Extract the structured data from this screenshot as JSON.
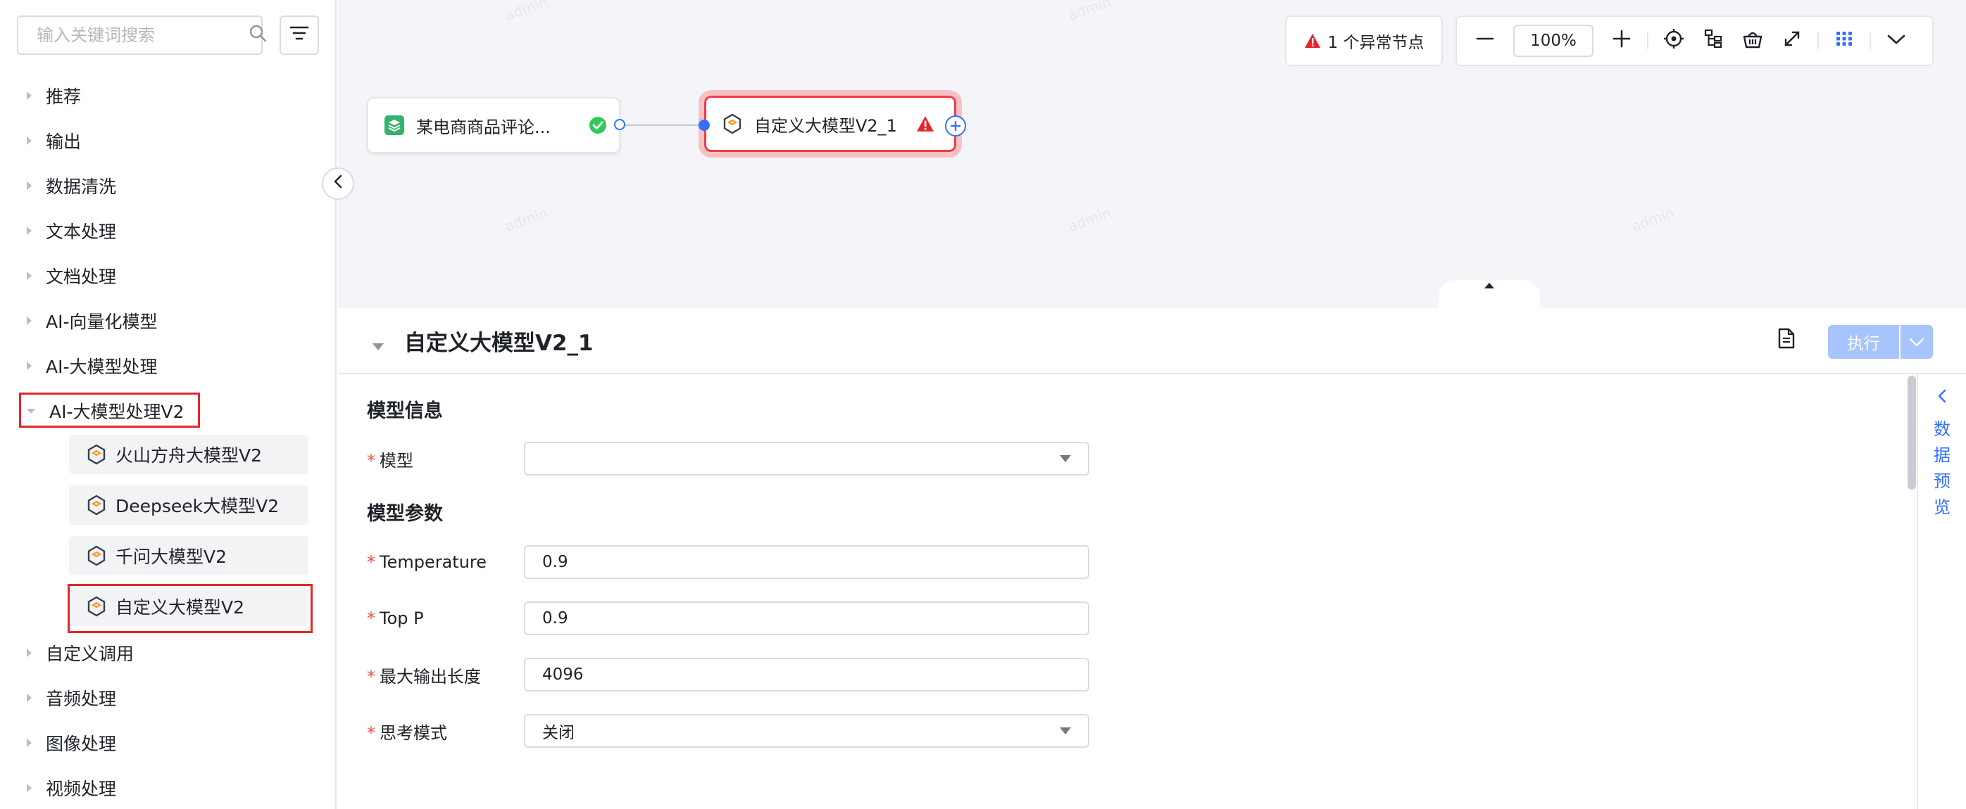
{
  "sidebar": {
    "search": {
      "placeholder": "输入关键词搜索",
      "value": ""
    },
    "categories": [
      {
        "label": "推荐"
      },
      {
        "label": "输出"
      },
      {
        "label": "数据清洗"
      },
      {
        "label": "文本处理"
      },
      {
        "label": "文档处理"
      },
      {
        "label": "AI-向量化模型"
      },
      {
        "label": "AI-大模型处理"
      },
      {
        "label": "AI-大模型处理V2"
      }
    ],
    "subitems": [
      {
        "label": "火山方舟大模型V2"
      },
      {
        "label": "Deepseek大模型V2"
      },
      {
        "label": "千问大模型V2"
      },
      {
        "label": "自定义大模型V2"
      }
    ],
    "more_categories": [
      {
        "label": "自定义调用"
      },
      {
        "label": "音频处理"
      },
      {
        "label": "图像处理"
      },
      {
        "label": "视频处理"
      }
    ]
  },
  "canvas": {
    "watermark": "admin",
    "alert": {
      "text": "1 个异常节点",
      "color": "#e4262c"
    },
    "zoom": "100%",
    "nodes": [
      {
        "label": "某电商商品评论...",
        "status": "ok"
      },
      {
        "label": "自定义大模型V2_1",
        "status": "error"
      }
    ],
    "toolbar_icons": [
      "zoom-out-icon",
      "zoom-in-icon",
      "locate-icon",
      "tree-layout-icon",
      "basket-icon",
      "fullscreen-icon",
      "grid-icon",
      "chevron-down-icon"
    ]
  },
  "panel": {
    "title": "自定义大模型V2_1",
    "run_label": "执行",
    "sections": {
      "model_info": "模型信息",
      "model_params": "模型参数"
    },
    "fields": {
      "model": {
        "label": "模型",
        "value": ""
      },
      "temperature": {
        "label": "Temperature",
        "value": "0.9"
      },
      "top_p": {
        "label": "Top P",
        "value": "0.9"
      },
      "max_len": {
        "label": "最大输出长度",
        "value": "4096"
      },
      "thinking": {
        "label": "思考模式",
        "value": "关闭"
      }
    },
    "preview_label": "数据预览"
  },
  "colors": {
    "accent": "#3370ff",
    "danger": "#e4262c",
    "success": "#34c759",
    "run_disabled": "#a8c4fc"
  }
}
